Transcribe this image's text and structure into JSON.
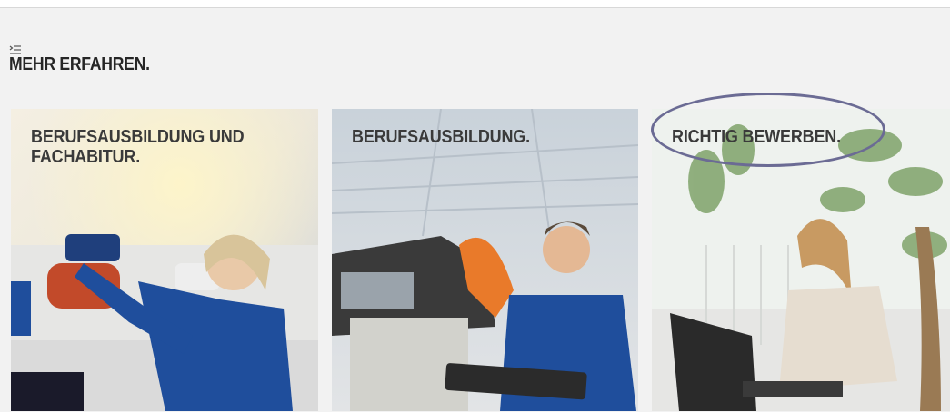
{
  "section": {
    "kicker_icon": "list-icon",
    "title": "MEHR ERFAHREN."
  },
  "cards": [
    {
      "title_line1": "BERUFSAUSBILDUNG UND",
      "title_line2": "FACHABITUR."
    },
    {
      "title_line1": "BERUFSAUSBILDUNG."
    },
    {
      "title_line1": "RICHTIG BEWERBEN."
    }
  ],
  "annotation": {
    "color": "#6b6b94"
  },
  "colors": {
    "title_text": "#262626",
    "card_text": "#3a3a3a",
    "uniform_blue": "#1f4e9c"
  }
}
